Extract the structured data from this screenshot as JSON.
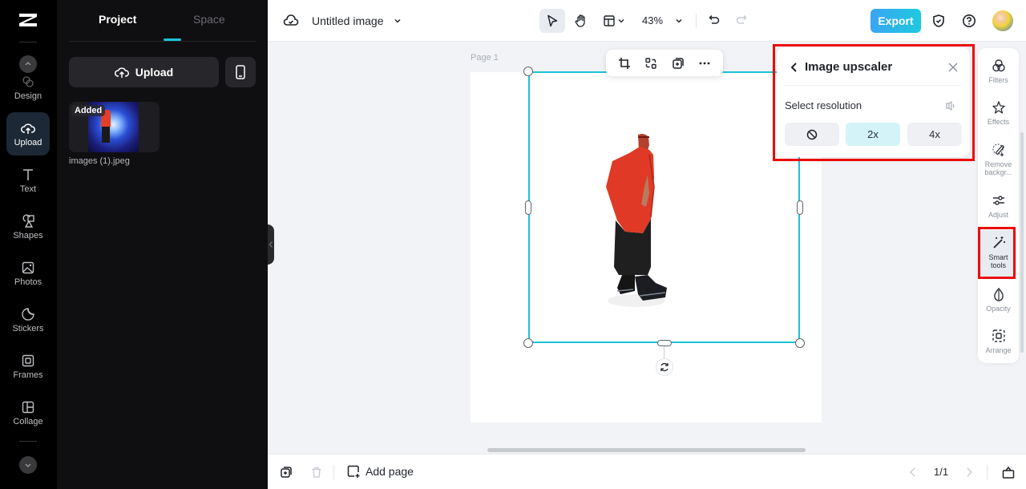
{
  "app": {
    "title": "Untitled image"
  },
  "rail": {
    "items": [
      {
        "label": "Design",
        "icon": "design-icon"
      },
      {
        "label": "Upload",
        "icon": "upload-cloud-icon",
        "active": true
      },
      {
        "label": "Text",
        "icon": "text-icon"
      },
      {
        "label": "Shapes",
        "icon": "shapes-icon"
      },
      {
        "label": "Photos",
        "icon": "photo-icon"
      },
      {
        "label": "Stickers",
        "icon": "sticker-icon"
      },
      {
        "label": "Frames",
        "icon": "frame-icon"
      },
      {
        "label": "Collage",
        "icon": "collage-icon"
      }
    ]
  },
  "panel": {
    "tabs": [
      {
        "label": "Project",
        "active": true
      },
      {
        "label": "Space",
        "active": false
      }
    ],
    "upload_label": "Upload",
    "media": [
      {
        "name": "images (1).jpeg",
        "badge": "Added"
      }
    ]
  },
  "topbar": {
    "zoom": "43%",
    "export_label": "Export"
  },
  "canvas": {
    "page_label": "Page 1"
  },
  "upscaler": {
    "title": "Image upscaler",
    "section_label": "Select resolution",
    "options": [
      {
        "label": "",
        "icon": "none-icon"
      },
      {
        "label": "2x",
        "selected": true
      },
      {
        "label": "4x"
      }
    ]
  },
  "right_tools": {
    "items": [
      {
        "label": "Filters",
        "icon": "filters-icon"
      },
      {
        "label": "Effects",
        "icon": "effects-icon"
      },
      {
        "label": "Remove backgr...",
        "icon": "remove-background-icon"
      },
      {
        "label": "Adjust",
        "icon": "adjust-icon"
      },
      {
        "label": "Smart tools",
        "icon": "smart-tools-icon",
        "active": true
      },
      {
        "label": "Opacity",
        "icon": "opacity-icon"
      },
      {
        "label": "Arrange",
        "icon": "arrange-icon"
      }
    ]
  },
  "bottombar": {
    "add_page_label": "Add page",
    "page_indicator": "1/1"
  },
  "colors": {
    "accent": "#1bc4d8",
    "highlight": "#ee0a0a",
    "export_gradient_start": "#3aa5f2",
    "export_gradient_end": "#1ec9df"
  }
}
